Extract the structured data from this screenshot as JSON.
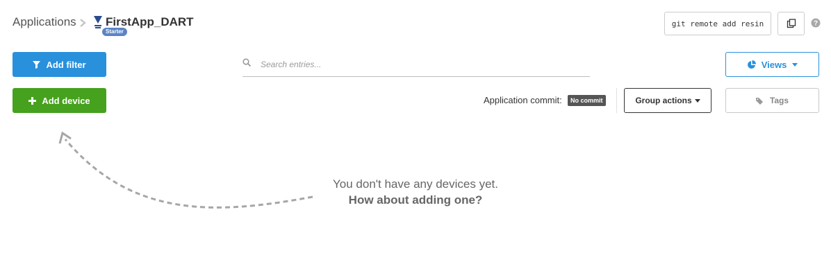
{
  "breadcrumb": {
    "root": "Applications",
    "app_name": "FirstApp_DART",
    "plan_badge": "Starter"
  },
  "header": {
    "git_command": "git remote add resin"
  },
  "toolbar": {
    "add_filter_label": "Add filter",
    "add_device_label": "Add device",
    "views_label": "Views",
    "group_actions_label": "Group actions",
    "tags_label": "Tags"
  },
  "search": {
    "placeholder": "Search entries..."
  },
  "commit": {
    "label": "Application commit:",
    "value": "No commit"
  },
  "empty_state": {
    "line1": "You don't have any devices yet.",
    "line2": "How about adding one?"
  },
  "colors": {
    "primary_blue": "#2990dc",
    "success_green": "#46a11e",
    "badge_blue": "#5b84c4",
    "commit_badge": "#555555"
  },
  "icons": {
    "breadcrumb_sep": "chevron-right-icon",
    "app": "device-type-icon",
    "copy": "copy-icon",
    "help": "help-icon",
    "filter": "filter-icon",
    "add": "plus-icon",
    "search": "search-icon",
    "views": "pie-chart-icon",
    "caret": "caret-down-icon",
    "tags": "tags-icon",
    "arrow": "dashed-arrow-icon"
  }
}
